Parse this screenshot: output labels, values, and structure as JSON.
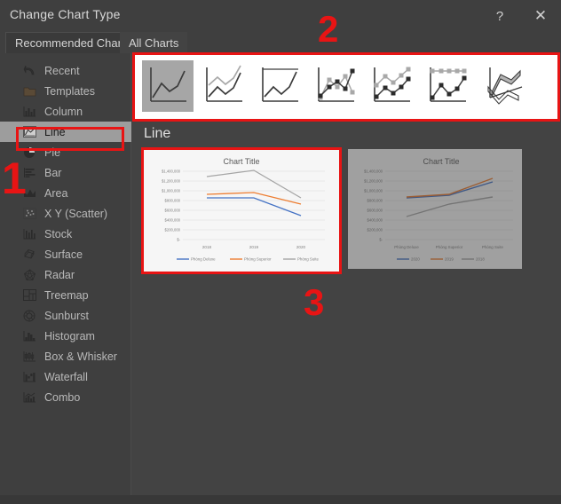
{
  "window": {
    "title": "Change Chart Type",
    "help_label": "?",
    "close_label": "✕"
  },
  "tabs": [
    {
      "label": "Recommended Charts",
      "active": false
    },
    {
      "label": "All Charts",
      "active": true
    }
  ],
  "sidebar": {
    "items": [
      {
        "label": "Recent",
        "icon": "recent-icon",
        "selected": false
      },
      {
        "label": "Templates",
        "icon": "templates-icon",
        "selected": false
      },
      {
        "label": "Column",
        "icon": "column-chart-icon",
        "selected": false
      },
      {
        "label": "Line",
        "icon": "line-chart-icon",
        "selected": true
      },
      {
        "label": "Pie",
        "icon": "pie-chart-icon",
        "selected": false
      },
      {
        "label": "Bar",
        "icon": "bar-chart-icon",
        "selected": false
      },
      {
        "label": "Area",
        "icon": "area-chart-icon",
        "selected": false
      },
      {
        "label": "X Y (Scatter)",
        "icon": "scatter-chart-icon",
        "selected": false
      },
      {
        "label": "Stock",
        "icon": "stock-chart-icon",
        "selected": false
      },
      {
        "label": "Surface",
        "icon": "surface-chart-icon",
        "selected": false
      },
      {
        "label": "Radar",
        "icon": "radar-chart-icon",
        "selected": false
      },
      {
        "label": "Treemap",
        "icon": "treemap-chart-icon",
        "selected": false
      },
      {
        "label": "Sunburst",
        "icon": "sunburst-chart-icon",
        "selected": false
      },
      {
        "label": "Histogram",
        "icon": "histogram-chart-icon",
        "selected": false
      },
      {
        "label": "Box & Whisker",
        "icon": "box-whisker-icon",
        "selected": false
      },
      {
        "label": "Waterfall",
        "icon": "waterfall-chart-icon",
        "selected": false
      },
      {
        "label": "Combo",
        "icon": "combo-chart-icon",
        "selected": false
      }
    ]
  },
  "gallery": {
    "items": [
      {
        "name": "line",
        "selected": true
      },
      {
        "name": "stacked-line",
        "selected": false
      },
      {
        "name": "100-percent-stacked-line",
        "selected": false
      },
      {
        "name": "line-with-markers",
        "selected": false
      },
      {
        "name": "stacked-line-with-markers",
        "selected": false
      },
      {
        "name": "100-percent-stacked-line-markers",
        "selected": false
      },
      {
        "name": "3d-line",
        "selected": false
      }
    ]
  },
  "main": {
    "section_heading": "Line"
  },
  "annotations": [
    {
      "id": "1",
      "label": "1"
    },
    {
      "id": "2",
      "label": "2"
    },
    {
      "id": "3",
      "label": "3"
    }
  ],
  "colors": {
    "accent_red": "#e81414",
    "series_1": "#4472C4",
    "series_2": "#ED7D31",
    "series_3": "#A5A5A5",
    "dialog_bg": "#434343",
    "sidebar_bg": "#3f3f3f",
    "selected_bg": "#9d9d9d"
  },
  "chart_data": [
    {
      "id": "preview-chart-1",
      "type": "line",
      "title": "Chart Title",
      "xlabel": "",
      "ylabel": "",
      "categories": [
        "2018",
        "2019",
        "2020"
      ],
      "series": [
        {
          "name": "Phòng Deluxe",
          "values": [
            850000,
            850000,
            490000
          ],
          "color": "#4472C4"
        },
        {
          "name": "Phòng Superior",
          "values": [
            930000,
            960000,
            730000
          ],
          "color": "#ED7D31"
        },
        {
          "name": "Phòng Suite",
          "values": [
            1290000,
            1410000,
            870000
          ],
          "color": "#A5A5A5"
        }
      ],
      "ylim": [
        0,
        1400000
      ],
      "ytick_labels": [
        "$1,400,000",
        "$1,200,000",
        "$1,000,000",
        "$800,000",
        "$600,000",
        "$400,000",
        "$200,000",
        "$-"
      ],
      "grid": true,
      "legend_position": "bottom"
    },
    {
      "id": "preview-chart-2",
      "type": "line",
      "title": "Chart Title",
      "xlabel": "",
      "ylabel": "",
      "categories": [
        "Phòng Deluxe",
        "Phòng Superior",
        "Phòng Suite"
      ],
      "series": [
        {
          "name": "2020",
          "values": [
            850000,
            900000,
            1280000
          ],
          "color": "#4472C4"
        },
        {
          "name": "2019",
          "values": [
            870000,
            920000,
            1400000
          ],
          "color": "#ED7D31"
        },
        {
          "name": "2018",
          "values": [
            480000,
            710000,
            880000
          ],
          "color": "#A5A5A5"
        }
      ],
      "ylim": [
        0,
        1400000
      ],
      "ytick_labels": [
        "$1,400,000",
        "$1,200,000",
        "$1,000,000",
        "$800,000",
        "$600,000",
        "$400,000",
        "$200,000",
        "$-"
      ],
      "grid": true,
      "legend_position": "bottom"
    }
  ]
}
